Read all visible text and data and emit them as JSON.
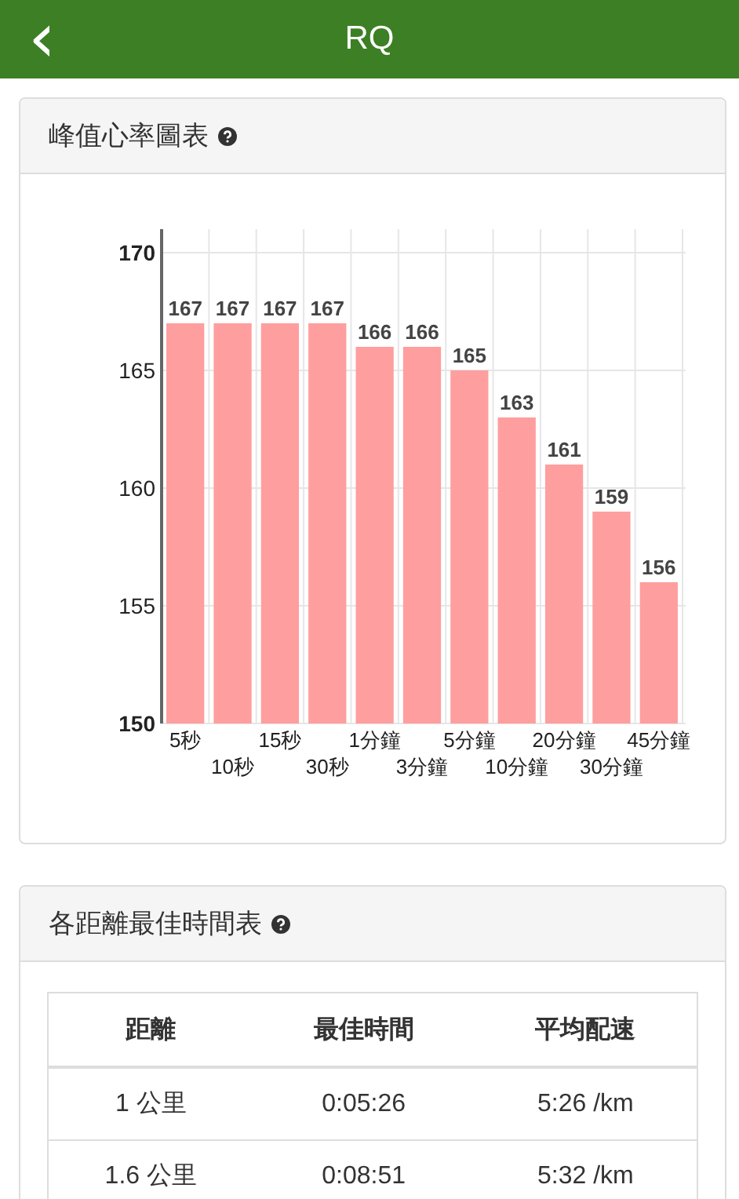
{
  "app_bar": {
    "back_icon": "‹",
    "title": "RQ"
  },
  "heart_rate_card": {
    "title": "峰值心率圖表",
    "chart_data": {
      "type": "bar",
      "categories": [
        "5秒",
        "10秒",
        "15秒",
        "30秒",
        "1分鐘",
        "3分鐘",
        "5分鐘",
        "10分鐘",
        "20分鐘",
        "30分鐘",
        "45分鐘"
      ],
      "series": [
        {
          "color": "#ff9e9e",
          "values": [
            167,
            167,
            167,
            167,
            166,
            166,
            165,
            163,
            161,
            159,
            156
          ]
        }
      ],
      "ylim": [
        150,
        170
      ],
      "yticks": [
        150,
        155,
        160,
        165,
        170
      ],
      "data_labels": true,
      "grid": true
    }
  },
  "best_times_card": {
    "title": "各距離最佳時間表",
    "table": {
      "columns": [
        "距離",
        "最佳時間",
        "平均配速"
      ],
      "rows": [
        [
          "1 公里",
          "0:05:26",
          "5:26 /km"
        ],
        [
          "1.6 公里",
          "0:08:51",
          "5:32 /km"
        ]
      ]
    }
  }
}
